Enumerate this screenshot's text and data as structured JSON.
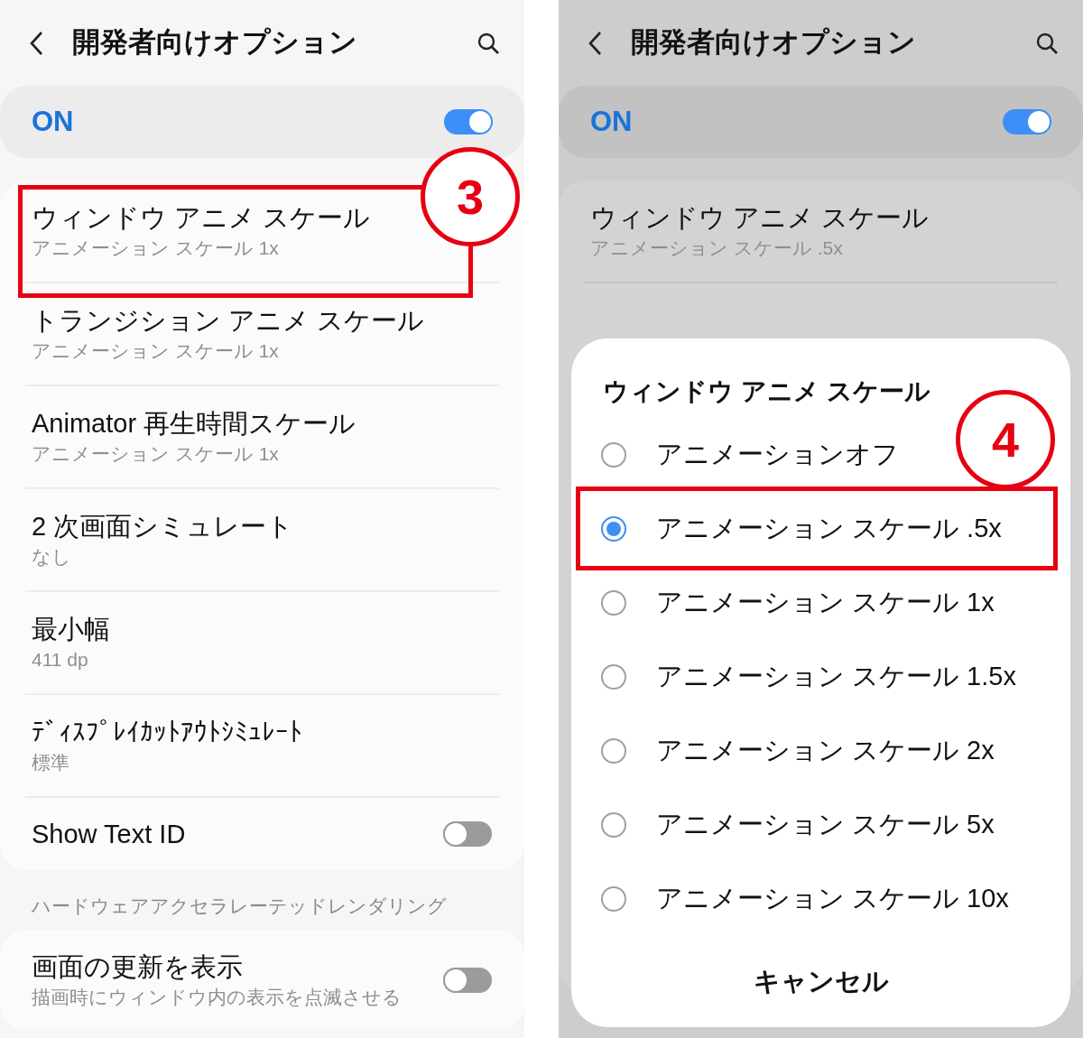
{
  "screens": [
    {
      "dimmed": false,
      "header": {
        "title": "開発者向けオプション"
      },
      "master": {
        "label": "ON",
        "on": true
      },
      "groups": [
        {
          "items": [
            {
              "kind": "value",
              "title": "ウィンドウ アニメ スケール",
              "subtitle": "アニメーション スケール 1x",
              "callout": "3"
            },
            {
              "kind": "value",
              "title": "トランジション アニメ スケール",
              "subtitle": "アニメーション スケール 1x"
            },
            {
              "kind": "value",
              "title": "Animator 再生時間スケール",
              "subtitle": "アニメーション スケール 1x"
            },
            {
              "kind": "value",
              "title": "2 次画面シミュレート",
              "subtitle": "なし"
            },
            {
              "kind": "value",
              "title": "最小幅",
              "subtitle": "411 dp"
            },
            {
              "kind": "value",
              "title": "ﾃﾞｨｽﾌﾟﾚｲｶｯﾄｱｳﾄｼﾐｭﾚｰﾄ",
              "subtitle": "標準"
            },
            {
              "kind": "switch",
              "title": "Show Text ID",
              "on": false
            }
          ]
        },
        {
          "section": "ハードウェアアクセラレーテッドレンダリング",
          "items": [
            {
              "kind": "switch",
              "title": "画面の更新を表示",
              "subtitle": "描画時にウィンドウ内の表示を点滅させる",
              "on": false
            }
          ]
        }
      ]
    },
    {
      "dimmed": true,
      "header": {
        "title": "開発者向けオプション"
      },
      "master": {
        "label": "ON",
        "on": true
      },
      "groups": [
        {
          "items": [
            {
              "kind": "value",
              "title": "ウィンドウ アニメ スケール",
              "subtitle": "アニメーション スケール .5x"
            }
          ]
        }
      ],
      "dialog": {
        "title": "ウィンドウ アニメ スケール",
        "options": [
          {
            "label": "アニメーションオフ",
            "selected": false
          },
          {
            "label": "アニメーション スケール .5x",
            "selected": true,
            "callout": "4"
          },
          {
            "label": "アニメーション スケール 1x",
            "selected": false
          },
          {
            "label": "アニメーション スケール 1.5x",
            "selected": false
          },
          {
            "label": "アニメーション スケール 2x",
            "selected": false
          },
          {
            "label": "アニメーション スケール 5x",
            "selected": false
          },
          {
            "label": "アニメーション スケール 10x",
            "selected": false
          }
        ],
        "cancel": "キャンセル"
      }
    }
  ]
}
